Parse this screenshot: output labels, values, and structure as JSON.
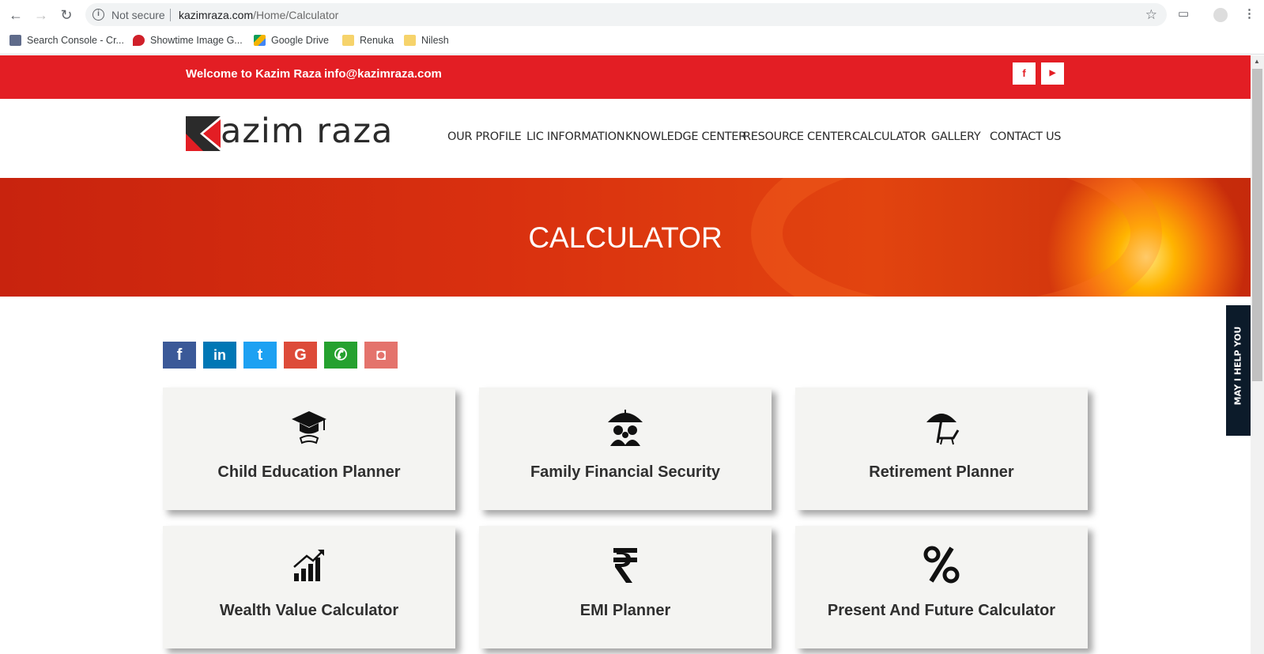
{
  "browser": {
    "security_label": "Not secure",
    "url_domain": "kazimraza.com",
    "url_path": "/Home/Calculator",
    "bookmarks": [
      {
        "label": "Search Console - Cr...",
        "icon": "search-console-icon"
      },
      {
        "label": "Showtime Image G...",
        "icon": "showtime-icon"
      },
      {
        "label": "Google Drive",
        "icon": "google-drive-icon"
      },
      {
        "label": "Renuka",
        "icon": "folder-icon"
      },
      {
        "label": "Nilesh",
        "icon": "folder-icon"
      }
    ]
  },
  "topbar": {
    "welcome": "Welcome to Kazim Raza",
    "email": "info@kazimraza.com",
    "social": [
      {
        "icon": "facebook-icon",
        "glyph": "f"
      },
      {
        "icon": "youtube-icon",
        "glyph": "▶"
      }
    ],
    "brand_color": "#e31e24"
  },
  "header": {
    "logo_text": "azim raza",
    "menu": [
      "OUR PROFILE",
      "LIC INFORMATION",
      "KNOWLEDGE CENTER",
      "RESOURCE CENTER",
      "CALCULATOR",
      "GALLERY",
      "CONTACT US"
    ]
  },
  "banner": {
    "title": "CALCULATOR"
  },
  "share_buttons": [
    {
      "icon": "facebook-share-icon",
      "glyph": "f",
      "color": "#3b5998"
    },
    {
      "icon": "linkedin-share-icon",
      "glyph": "in",
      "color": "#0077b5"
    },
    {
      "icon": "twitter-share-icon",
      "glyph": "t",
      "color": "#1da1f2"
    },
    {
      "icon": "google-share-icon",
      "glyph": "G",
      "color": "#dd4b39"
    },
    {
      "icon": "whatsapp-share-icon",
      "glyph": "✆",
      "color": "#25a12f"
    },
    {
      "icon": "instagram-share-icon",
      "glyph": "◘",
      "color": "#e4736c"
    }
  ],
  "calculators": [
    {
      "title": "Child Education Planner",
      "icon": "graduation-cap-icon"
    },
    {
      "title": "Family Financial Security",
      "icon": "family-umbrella-icon"
    },
    {
      "title": "Retirement Planner",
      "icon": "beach-umbrella-icon"
    },
    {
      "title": "Wealth Value Calculator",
      "icon": "growth-chart-icon"
    },
    {
      "title": "EMI Planner",
      "icon": "rupee-icon"
    },
    {
      "title": "Present And Future Calculator",
      "icon": "percent-icon"
    }
  ],
  "help_tab": {
    "label": "MAY I HELP YOU"
  }
}
